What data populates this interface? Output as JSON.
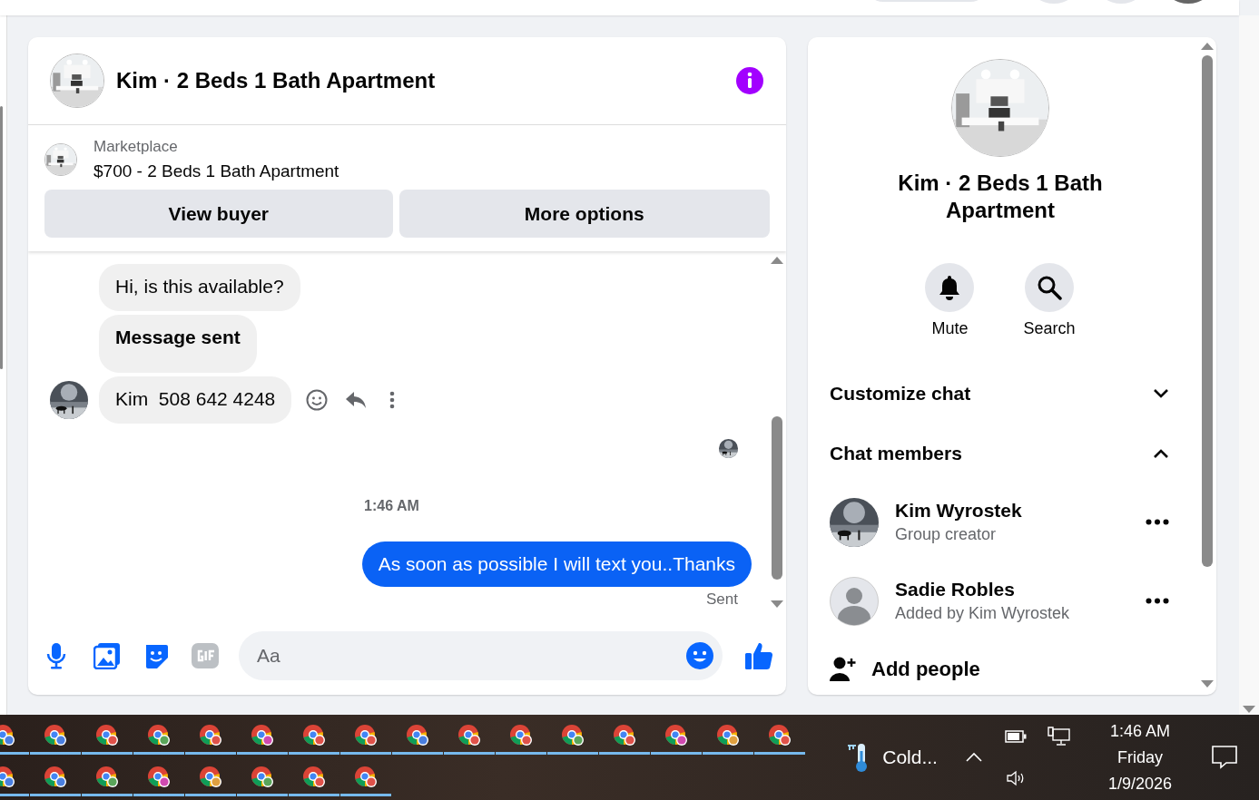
{
  "chat": {
    "title": "Kim · 2 Beds 1 Bath Apartment",
    "listing": {
      "source": "Marketplace",
      "title": "$700 - 2 Beds 1 Bath Apartment"
    },
    "buttons": [
      "View buyer",
      "More options"
    ],
    "messages": [
      {
        "kind": "incoming",
        "text": "Hi, is this available?",
        "bold": false,
        "avatar": false
      },
      {
        "kind": "incoming",
        "text": "Message sent",
        "bold": true,
        "avatar": false
      },
      {
        "kind": "incoming",
        "text": "Kim  508 642 4248",
        "bold": false,
        "avatar": true
      },
      {
        "kind": "seen"
      },
      {
        "kind": "timestamp",
        "text": "1:46 AM"
      },
      {
        "kind": "outgoing",
        "text": "As soon as possible I will text you..Thanks",
        "status": "Sent"
      }
    ],
    "composer": {
      "placeholder": "Aa"
    }
  },
  "details": {
    "title": "Kim · 2 Beds 1 Bath Apartment",
    "actions": [
      {
        "kind": "mute",
        "label": "Mute"
      },
      {
        "kind": "search",
        "label": "Search"
      }
    ],
    "sections": [
      {
        "label": "Customize chat",
        "expanded": false
      },
      {
        "label": "Chat members",
        "expanded": true
      }
    ],
    "members": [
      {
        "name": "Kim Wyrostek",
        "role": "Group creator"
      },
      {
        "name": "Sadie Robles",
        "role": "Added by Kim Wyrostek",
        "kind": "default"
      }
    ],
    "add_label": "Add people"
  },
  "taskbar": {
    "rows": [
      {
        "apps": [
          {
            "color": "#4a7fe0"
          },
          {
            "color": "#4a7fe0"
          },
          {
            "color": "#e0524a"
          },
          {
            "color": "#5aa55a"
          },
          {
            "color": "#e0524a"
          },
          {
            "color": "#d04ab0"
          },
          {
            "color": "#e0524a"
          },
          {
            "color": "#e0524a"
          },
          {
            "color": "#4a7fe0"
          },
          {
            "color": "#e0524a"
          },
          {
            "color": "#e0524a"
          },
          {
            "color": "#5aa55a"
          },
          {
            "color": "#e0524a"
          },
          {
            "color": "#d04ab0"
          },
          {
            "color": "#e0a040"
          },
          {
            "color": "#e0524a"
          }
        ]
      },
      {
        "apps": [
          {
            "color": "#4a7fe0"
          },
          {
            "color": "#4a7fe0"
          },
          {
            "color": "#5aa55a"
          },
          {
            "color": "#d04ab0"
          },
          {
            "color": "#e0a040"
          },
          {
            "color": "#5aa55a"
          },
          {
            "color": "#e0524a"
          },
          {
            "color": "#e0524a"
          }
        ]
      }
    ],
    "weather": "Cold...",
    "clock": {
      "time": "1:46 AM",
      "day": "Friday",
      "date": "1/9/2026"
    }
  }
}
